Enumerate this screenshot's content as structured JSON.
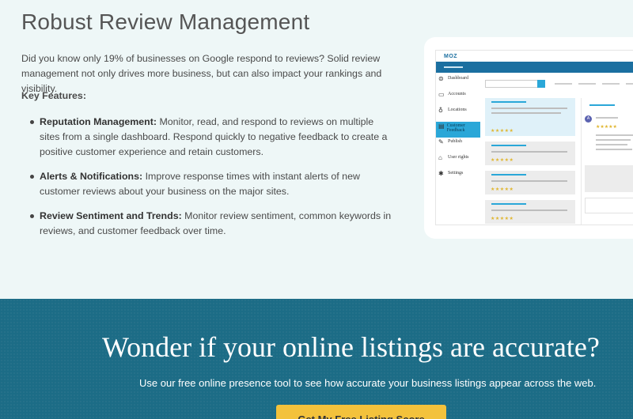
{
  "section": {
    "heading": "Robust Review Management",
    "intro": "Did you know only 19% of businesses on Google respond to reviews? Solid review management not only drives more business, but can also impact your rankings and visibility.",
    "key_features_label": "Key Features:",
    "features": [
      {
        "title": "Reputation Management:",
        "text": " Monitor, read, and respond to reviews on multiple sites from a single dashboard. Respond quickly to negative feedback to create a positive customer experience and retain customers."
      },
      {
        "title": "Alerts & Notifications:",
        "text": " Improve response times with instant alerts of new customer reviews about your business on the major sites."
      },
      {
        "title": "Review Sentiment and Trends:",
        "text": " Monitor review sentiment, common keywords in reviews, and customer feedback over time."
      }
    ]
  },
  "mock": {
    "logo": "MOZ",
    "sidebar": [
      {
        "label": "Dashboard",
        "icon": "dashboard-icon"
      },
      {
        "label": "Accounts",
        "icon": "folder-icon"
      },
      {
        "label": "Locations",
        "icon": "location-pin-icon"
      },
      {
        "label": "Customer Feedback",
        "icon": "feedback-icon"
      },
      {
        "label": "Publish",
        "icon": "publish-icon"
      },
      {
        "label": "User rights",
        "icon": "lock-icon"
      },
      {
        "label": "Settings",
        "icon": "gear-icon"
      }
    ],
    "stars": "★★★★★",
    "avatar_letter": "A"
  },
  "cta": {
    "title": "Wonder if your online listings are accurate?",
    "subtitle": "Use our free online presence tool to see how accurate your business listings appear across the web.",
    "button_label": "Get My Free Listing Score"
  },
  "colors": {
    "page_bg": "#eef7f7",
    "band_bg": "#1c6c86",
    "accent": "#2aa7d8",
    "button": "#f3c23c"
  }
}
